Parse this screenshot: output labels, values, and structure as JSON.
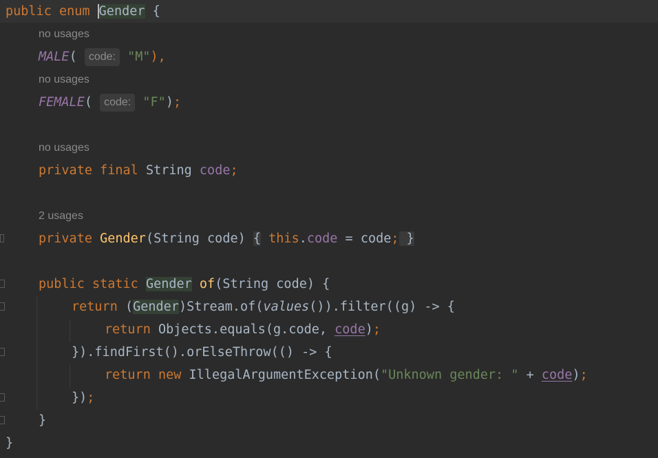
{
  "editor": {
    "lines": {
      "l1": {
        "public": "public",
        "enum": "enum",
        "name": "Gender",
        "brace": " {"
      },
      "lens_male": "no usages",
      "male": {
        "const": "MALE",
        "open": "(",
        "hint": "code:",
        "value": "\"M\"",
        "close": "),",
        "comma": ""
      },
      "lens_female": "no usages",
      "female": {
        "const": "FEMALE",
        "open": "(",
        "hint": "code:",
        "value": "\"F\"",
        "close": ")",
        "semi": ";"
      },
      "lens_field": "no usages",
      "field": {
        "private": "private",
        "final": "final",
        "type": "String",
        "name": "code",
        "semi": ";"
      },
      "lens_ctor": "2 usages",
      "ctor": {
        "private": "private",
        "name": "Gender",
        "params": "(String code)",
        "open": "{",
        "this": "this",
        "dot": ".",
        "field": "code",
        "assign": " = code",
        "semi": ";",
        "close": "}"
      },
      "of": {
        "public": "public",
        "static": "static",
        "type": "Gender",
        "name": "of",
        "params": "(String code) {"
      },
      "ret1": {
        "return": "return",
        "cast_open": "(",
        "cast": "Gender",
        "rest1": ")Stream.of(",
        "values": "values",
        "rest2": "()).filter((g) -> {"
      },
      "ret2": {
        "return": "return",
        "rest": "Objects.equals(g.code, ",
        "code": "code",
        "end": ")",
        "semi": ";"
      },
      "find": {
        "text": "}).findFirst().orElseThrow(() -> {"
      },
      "ret3": {
        "return": "return",
        "new": "new",
        "cls": "IllegalArgumentException(",
        "str": "\"Unknown gender: \"",
        "plus": " + ",
        "code": "code",
        "end": ")",
        "semi": ";"
      },
      "close_lambda": {
        "text": "})",
        "semi": ";"
      },
      "close_method": "}",
      "close_enum": "}"
    }
  }
}
